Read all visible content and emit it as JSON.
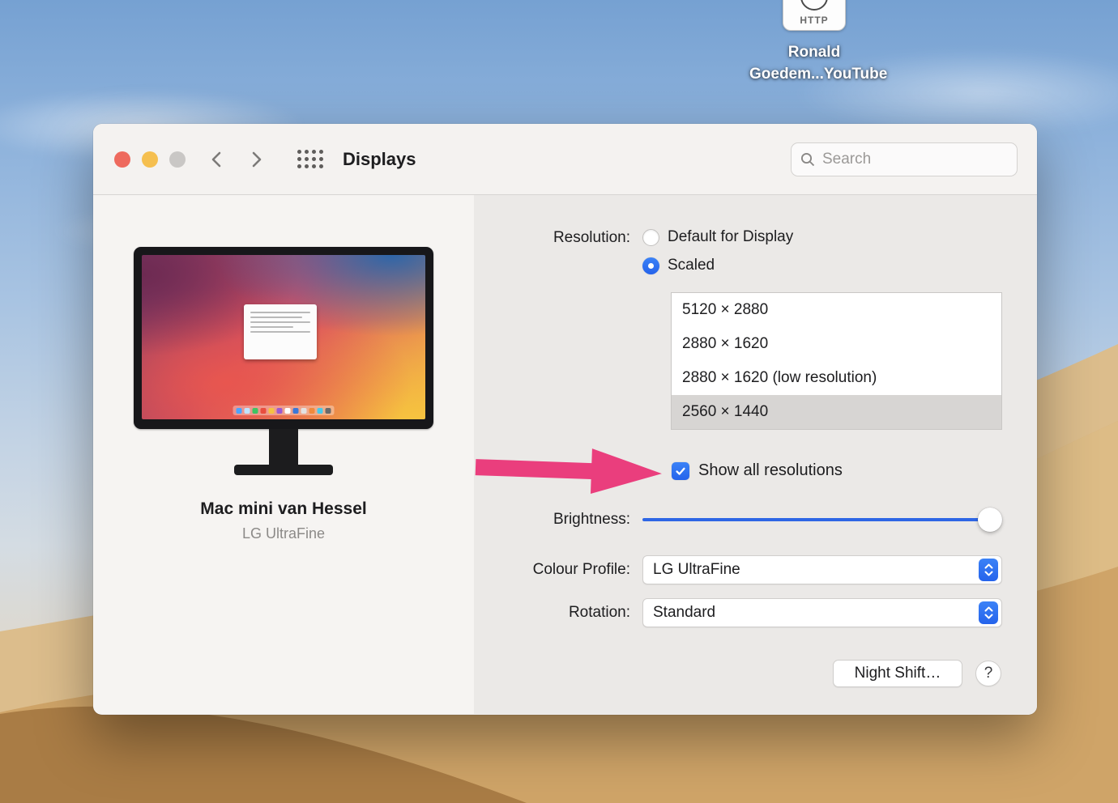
{
  "desktop": {
    "shortcut": {
      "badge": "HTTP",
      "label_line1": "Ronald",
      "label_line2": "Goedem...YouTube"
    }
  },
  "window": {
    "title": "Displays",
    "search": {
      "placeholder": "Search"
    },
    "display": {
      "name": "Mac mini van Hessel",
      "model": "LG UltraFine"
    },
    "resolution": {
      "label": "Resolution:",
      "options": [
        {
          "label": "Default for Display",
          "selected": false
        },
        {
          "label": "Scaled",
          "selected": true
        }
      ],
      "list": [
        "5120 × 2880",
        "2880 × 1620",
        "2880 × 1620 (low resolution)",
        "2560 × 1440"
      ],
      "selected_index": 3
    },
    "show_all": {
      "label": "Show all resolutions",
      "checked": true
    },
    "brightness": {
      "label": "Brightness:",
      "value_percent": 100
    },
    "colour_profile": {
      "label": "Colour Profile:",
      "value": "LG UltraFine"
    },
    "rotation": {
      "label": "Rotation:",
      "value": "Standard"
    },
    "night_shift": {
      "label": "Night Shift…"
    },
    "help": {
      "label": "?"
    }
  },
  "colors": {
    "accent_blue": "#2563eb",
    "arrow_pink": "#ea3e7d",
    "traffic_red": "#ee6a5e",
    "traffic_yellow": "#f5bf4f",
    "traffic_gray": "#c9c7c5",
    "selected_row": "#d7d5d3"
  }
}
